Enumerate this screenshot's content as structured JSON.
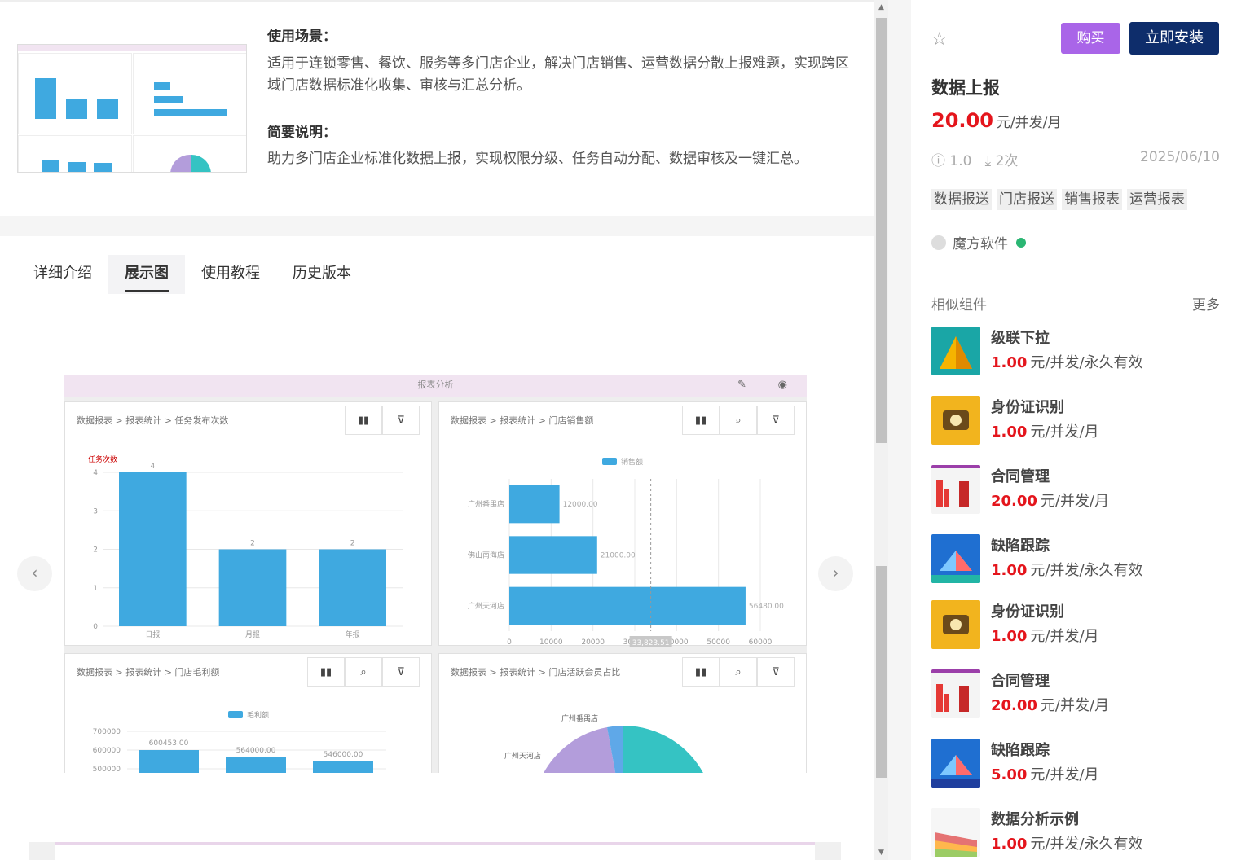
{
  "detail": {
    "scene_label": "使用场景：",
    "scene_text": "适用于连锁零售、餐饮、服务等多门店企业，解决门店销售、运营数据分散上报难题，实现跨区域门店数据标准化收集、审核与汇总分析。",
    "brief_label": "简要说明：",
    "brief_text": "助力多门店企业标准化数据上报，实现权限分级、任务自动分配、数据审核及一键汇总。"
  },
  "tabs": [
    "详细介绍",
    "展示图",
    "使用教程",
    "历史版本"
  ],
  "active_tab": 1,
  "screenshot": {
    "header": "报表分析",
    "panels": [
      {
        "crumb": "数据报表 > 报表统计 > 任务发布次数"
      },
      {
        "crumb": "数据报表 > 报表统计 > 门店销售额"
      },
      {
        "crumb": "数据报表 > 报表统计 > 门店毛利额"
      },
      {
        "crumb": "数据报表 > 报表统计 > 门店活跃会员占比"
      }
    ],
    "chart1": {
      "ylabel": "任务次数",
      "categories": [
        "日报",
        "月报",
        "年报"
      ],
      "values": [
        4,
        2,
        2
      ],
      "yticks": [
        "4",
        "3",
        "2",
        "1",
        "0"
      ]
    },
    "chart2": {
      "legend": "销售额",
      "categories": [
        "广州番禺店",
        "佛山南海店",
        "广州天河店"
      ],
      "values": [
        12000,
        21000,
        56480
      ],
      "value_labels": [
        "12000.00",
        "21000.00",
        "56480.00"
      ],
      "xticks": [
        "0",
        "10000",
        "20000",
        "30000",
        "40000",
        "50000",
        "60000"
      ],
      "tooltip": "33,823.51"
    },
    "chart3": {
      "legend": "毛利额",
      "yticks": [
        "700000",
        "600000",
        "500000"
      ],
      "value_labels": [
        "600453.00",
        "564000.00",
        "546000.00"
      ]
    },
    "chart4": {
      "labels": [
        "广州番禺店",
        "广州天河店"
      ]
    }
  },
  "product": {
    "buy": "购买",
    "install": "立即安装",
    "name": "数据上报",
    "price": "20.00",
    "price_unit": "元/并发/月",
    "version": "1.0",
    "downloads": "2次",
    "date": "2025/06/10",
    "tags": [
      "数据报送",
      "门店报送",
      "销售报表",
      "运营报表"
    ],
    "author": "魔方软件"
  },
  "similar": {
    "title": "相似组件",
    "more": "更多",
    "items": [
      {
        "name": "级联下拉",
        "price": "1.00",
        "unit": "元/并发/永久有效"
      },
      {
        "name": "身份证识别",
        "price": "1.00",
        "unit": "元/并发/月"
      },
      {
        "name": "合同管理",
        "price": "20.00",
        "unit": "元/并发/月"
      },
      {
        "name": "缺陷跟踪",
        "price": "1.00",
        "unit": "元/并发/永久有效"
      },
      {
        "name": "身份证识别",
        "price": "1.00",
        "unit": "元/并发/月"
      },
      {
        "name": "合同管理",
        "price": "20.00",
        "unit": "元/并发/月"
      },
      {
        "name": "缺陷跟踪",
        "price": "5.00",
        "unit": "元/并发/月"
      },
      {
        "name": "数据分析示例",
        "price": "1.00",
        "unit": "元/并发/永久有效"
      }
    ]
  },
  "colors": {
    "buy": "#a965e8",
    "install": "#0e2d6b",
    "price": "#e4151c",
    "bar": "#3fa9e0"
  }
}
